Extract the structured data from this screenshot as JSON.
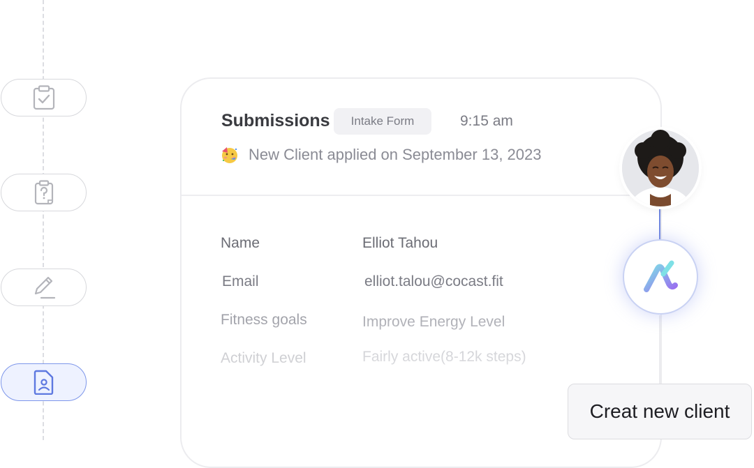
{
  "steps": [
    {
      "icon": "clipboard-check-icon",
      "active": false
    },
    {
      "icon": "clipboard-question-icon",
      "active": false
    },
    {
      "icon": "pen-icon",
      "active": false
    },
    {
      "icon": "user-document-icon",
      "active": true
    }
  ],
  "card": {
    "title": "Submissions",
    "badge": "Intake Form",
    "time": "9:15 am",
    "emoji": "party-face-emoji",
    "subtitle": "New Client applied on September 13, 2023",
    "fields": [
      {
        "label": "Name",
        "value": "Elliot Tahou"
      },
      {
        "label": "Email",
        "value": "elliot.talou@cocast.fit"
      },
      {
        "label": "Fitness goals",
        "value": "Improve Energy Level"
      },
      {
        "label": "Activity Level",
        "value": "Fairly active(8-12k steps)"
      }
    ]
  },
  "colors": {
    "accent": "#6f86df",
    "active_step_bg": "#eef2ff",
    "logo_gradient_start": "#7ee0e6",
    "logo_gradient_end": "#9a6cf0"
  },
  "cta": {
    "label": "Creat new client"
  }
}
